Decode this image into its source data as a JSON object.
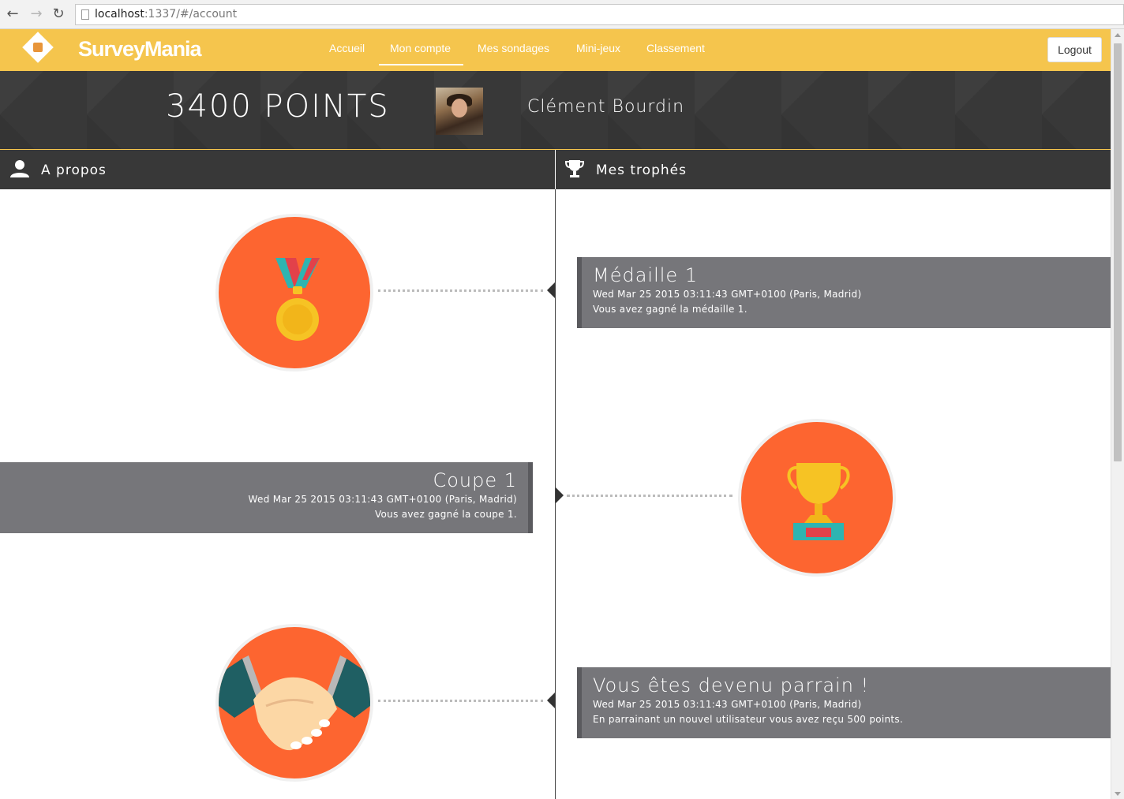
{
  "browser": {
    "url_host": "localhost",
    "url_rest": ":1337/#/account"
  },
  "navbar": {
    "brand": "SurveyMania",
    "links": [
      {
        "label": "Accueil"
      },
      {
        "label": "Mon compte",
        "active": true
      },
      {
        "label": "Mes sondages"
      },
      {
        "label": "Mini-jeux"
      },
      {
        "label": "Classement"
      }
    ],
    "logout_label": "Logout"
  },
  "profile": {
    "points_label": "3400 POINTS",
    "name": "Clément Bourdin"
  },
  "sections": {
    "about_label": "A propos",
    "trophies_label": "Mes trophés"
  },
  "timeline": [
    {
      "title": "Médaille 1",
      "date": "Wed Mar 25 2015 03:11:43 GMT+0100 (Paris, Madrid)",
      "description": "Vous avez gagné la médaille 1.",
      "icon": "medal-icon"
    },
    {
      "title": "Coupe 1",
      "date": "Wed Mar 25 2015 03:11:43 GMT+0100 (Paris, Madrid)",
      "description": "Vous avez gagné la coupe 1.",
      "icon": "trophy-cup-icon"
    },
    {
      "title": "Vous êtes devenu parrain !",
      "date": "Wed Mar 25 2015 03:11:43 GMT+0100 (Paris, Madrid)",
      "description": "En parrainant un nouvel utilisateur vous avez reçu 500 points.",
      "icon": "handshake-icon"
    }
  ],
  "colors": {
    "navbar": "#f5c54d",
    "dark": "#383838",
    "accent": "#fd6530",
    "card": "#76767a"
  }
}
